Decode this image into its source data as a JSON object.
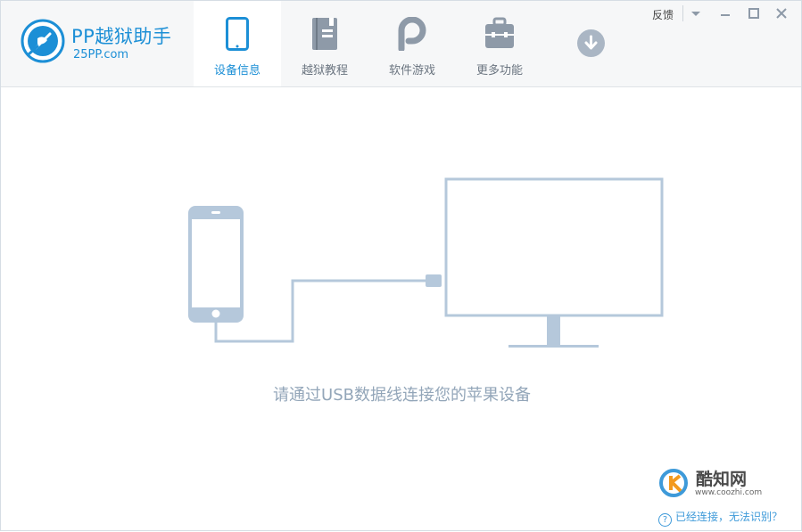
{
  "app": {
    "name": "PP越狱助手",
    "domain": "25PP.com"
  },
  "tabs": [
    {
      "label": "设备信息",
      "icon": "phone-icon",
      "active": true
    },
    {
      "label": "越狱教程",
      "icon": "book-icon",
      "active": false
    },
    {
      "label": "软件游戏",
      "icon": "pp-logo-icon",
      "active": false
    },
    {
      "label": "更多功能",
      "icon": "toolbox-icon",
      "active": false
    }
  ],
  "window_controls": {
    "feedback": "反馈"
  },
  "main": {
    "hint": "请通过USB数据线连接您的苹果设备"
  },
  "watermark": {
    "title": "酷知网",
    "url": "www.coozhi.com"
  },
  "footer": {
    "help_icon": "?",
    "help_link": "已经连接，无法识别？"
  },
  "colors": {
    "accent": "#1c8fd6",
    "illustration": "#b5c8db",
    "hint": "#93a6b9"
  }
}
